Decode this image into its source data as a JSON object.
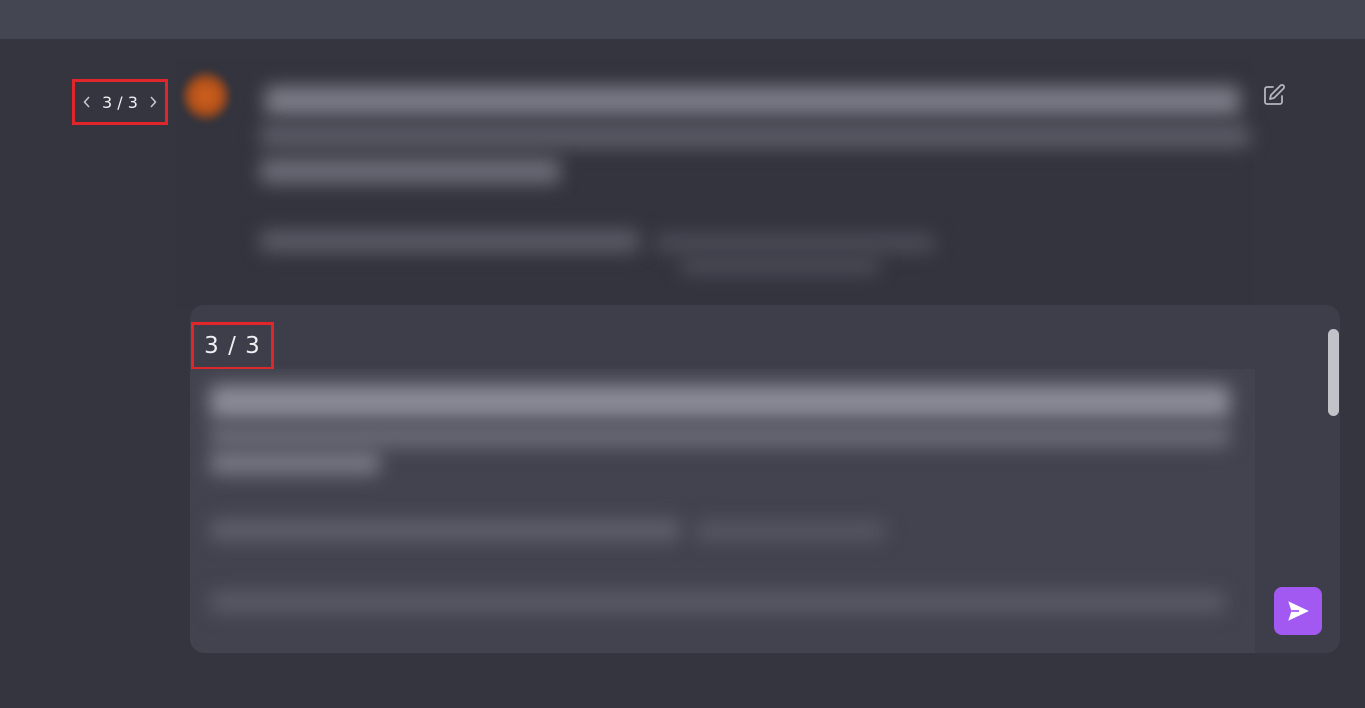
{
  "window": {
    "title": ""
  },
  "conversation": {
    "pager": {
      "label": "3 / 3",
      "prev_icon": "chevron-left-icon",
      "next_icon": "chevron-right-icon"
    },
    "edit_icon": "pencil-square-icon"
  },
  "composer": {
    "counter_label": "3 / 3",
    "send_icon": "send-icon",
    "accent_color": "#a259f2"
  },
  "highlight_color": "#e0262b"
}
